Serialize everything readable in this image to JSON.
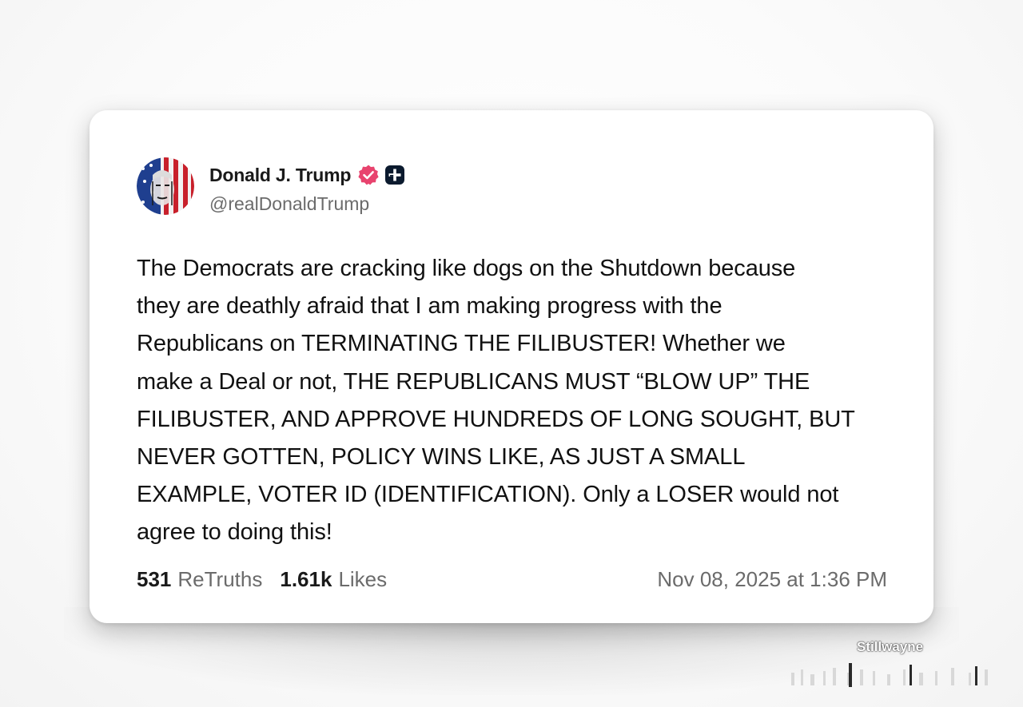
{
  "post": {
    "author": {
      "display_name": "Donald J. Trump",
      "handle": "@realDonaldTrump",
      "avatar_icon": "flag-portrait-avatar-icon",
      "verified_icon": "verified-badge-icon",
      "extra_badge_icon": "plus-badge-icon"
    },
    "text": "The Democrats are cracking like dogs on the Shutdown because\nthey are deathly afraid that I am making progress with the\nRepublicans on TERMINATING THE FILIBUSTER! Whether we\nmake a Deal or not, THE REPUBLICANS MUST “BLOW UP” THE\nFILIBUSTER, AND APPROVE HUNDREDS OF LONG SOUGHT, BUT\nNEVER GOTTEN, POLICY WINS LIKE, AS JUST A SMALL\nEXAMPLE, VOTER ID (IDENTIFICATION). Only a LOSER would not\nagree to doing this!",
    "stats": {
      "retruths_count": "531",
      "retruths_label": "ReTruths",
      "likes_count": "1.61k",
      "likes_label": "Likes"
    },
    "timestamp": "Nov 08, 2025 at 1:36 PM"
  },
  "watermark": "Stillwayne",
  "colors": {
    "verified_badge": "#e8436e",
    "plus_badge": "#0b1a2e",
    "secondary_text": "#6b6b6b",
    "primary_text": "#111111"
  }
}
